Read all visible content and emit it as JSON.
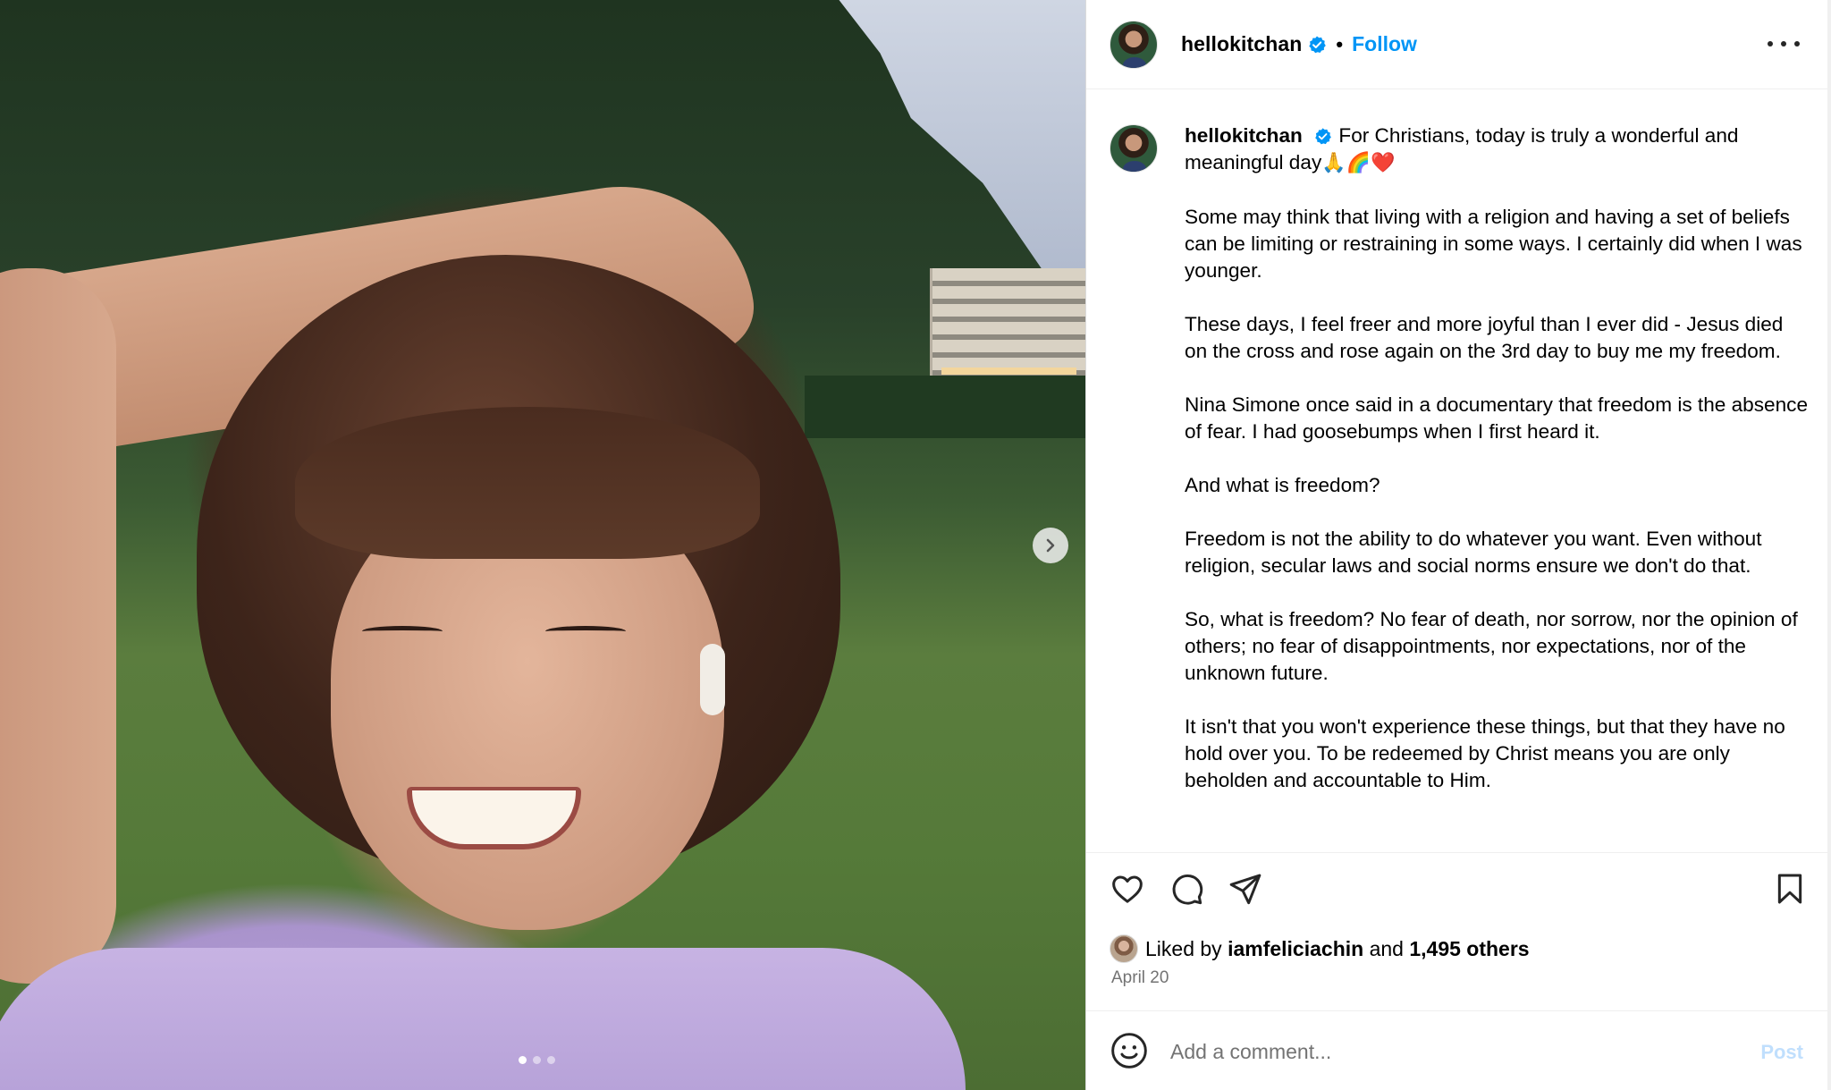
{
  "post": {
    "media": {
      "slide_index": 1,
      "slide_count": 3
    },
    "header": {
      "username": "hellokitchan",
      "verified": true,
      "separator": "•",
      "follow_label": "Follow"
    },
    "caption": {
      "username": "hellokitchan",
      "first_line": "For Christians, today is truly a wonderful and meaningful day",
      "first_line_emoji": "🙏🌈❤️",
      "paragraphs": [
        "Some may think that living with a religion and having a set of beliefs can be limiting or restraining in some ways.  I certainly did when I was younger.",
        "These days, I feel freer and more joyful than I ever did - Jesus died on the cross and rose again on the 3rd day to buy me my freedom.",
        "Nina Simone once said in a documentary that freedom is the absence of fear. I had goosebumps when I first heard it.",
        "And what is freedom?",
        "Freedom is not the ability to do whatever you want. Even without religion, secular laws and social norms ensure we don't do that.",
        "So, what is freedom? No fear of death, nor sorrow, nor the opinion of others; no fear of disappointments, nor expectations, nor of the unknown future.",
        "It isn't that you won't experience these things, but that they have no hold over you. To be redeemed by Christ means you are only beholden and accountable to Him."
      ]
    },
    "likes": {
      "prefix": "Liked by",
      "liked_by_user": "iamfeliciachin",
      "connector": "and",
      "others": "1,495 others"
    },
    "date": "April 20",
    "comment": {
      "placeholder": "Add a comment...",
      "post_label": "Post"
    }
  },
  "colors": {
    "link_blue": "#0095f6",
    "post_disabled": "#c0dffd",
    "meta_gray": "#737373",
    "divider": "#efefef"
  },
  "icons": [
    "verified-badge-icon",
    "more-options-icon",
    "heart-icon",
    "comment-icon",
    "share-icon",
    "bookmark-icon",
    "emoji-icon",
    "chevron-right-icon"
  ]
}
